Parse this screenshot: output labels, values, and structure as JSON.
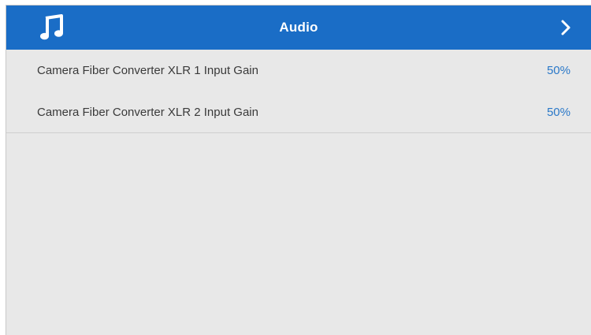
{
  "header": {
    "title": "Audio",
    "icon": "music-note-icon",
    "next_icon": "chevron-right-icon",
    "color": "#1a6dc6"
  },
  "settings": [
    {
      "label": "Camera Fiber Converter XLR 1 Input Gain",
      "value": "50%"
    },
    {
      "label": "Camera Fiber Converter XLR 2 Input Gain",
      "value": "50%"
    }
  ],
  "colors": {
    "background": "#e8e8e8",
    "value_text": "#2a78c8",
    "label_text": "#3a3a3a"
  }
}
